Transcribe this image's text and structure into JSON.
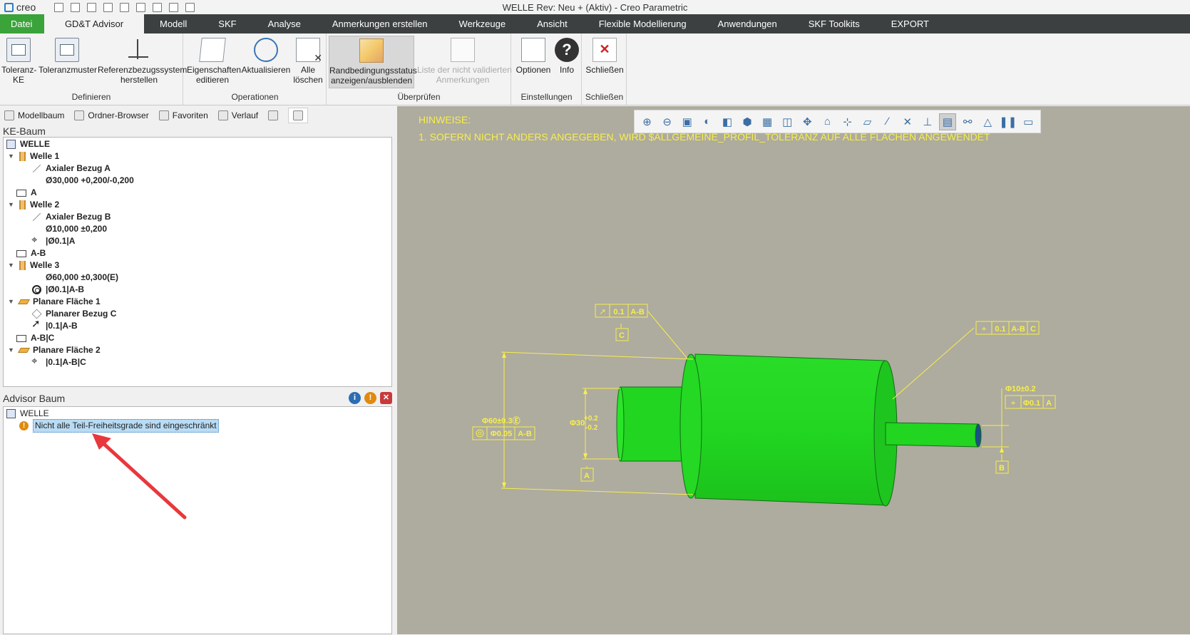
{
  "app": {
    "logo_text": "creo",
    "window_title": "WELLE Rev: Neu + (Aktiv) - Creo Parametric",
    "quick_access_icons": [
      "new-icon",
      "open-icon",
      "folder-icon",
      "save-icon",
      "undo-icon",
      "redo-icon",
      "regenerate-icon",
      "windows-icon",
      "close-window-icon"
    ]
  },
  "menu": {
    "file": "Datei",
    "tabs": [
      "GD&T Advisor",
      "Modell",
      "SKF",
      "Analyse",
      "Anmerkungen erstellen",
      "Werkzeuge",
      "Ansicht",
      "Flexible Modellierung",
      "Anwendungen",
      "SKF Toolkits",
      "EXPORT"
    ],
    "active_tab": "GD&T Advisor"
  },
  "ribbon": {
    "groups": {
      "definieren": "Definieren",
      "operationen": "Operationen",
      "ueberpruefen": "Überprüfen",
      "einstellungen": "Einstellungen",
      "schliessen": "Schließen"
    },
    "buttons": {
      "toleranz_ke_1": "Toleranz-",
      "toleranz_ke_2": "KE",
      "toleranzmuster": "Toleranzmuster",
      "refsys_1": "Referenzbezugssystem",
      "refsys_2": "herstellen",
      "eigenschaften_1": "Eigenschaften",
      "eigenschaften_2": "editieren",
      "aktualisieren": "Aktualisieren",
      "alle_1": "Alle",
      "alle_2": "löschen",
      "randbed_1": "Randbedingungsstatus",
      "randbed_2": "anzeigen/ausblenden",
      "liste_1": "Liste der nicht validierten",
      "liste_2": "Anmerkungen",
      "optionen": "Optionen",
      "info": "Info",
      "info_glyph": "?",
      "schliessen": "Schließen",
      "close_glyph": "✕"
    }
  },
  "navigator": {
    "tabs": [
      "Modellbaum",
      "Ordner-Browser",
      "Favoriten",
      "Verlauf"
    ],
    "ke_tree_title": "KE-Baum",
    "ke_tree": [
      {
        "label": "WELLE",
        "icon": "part-icon",
        "level": 0,
        "expand": ""
      },
      {
        "label": "Welle 1",
        "icon": "feature-icon",
        "level": 0,
        "expand": "▼"
      },
      {
        "label": "Axialer Bezug A",
        "icon": "axis-icon",
        "level": 2,
        "expand": ""
      },
      {
        "label": "Ø30,000 +0,200/-0,200",
        "icon": "",
        "level": 2,
        "expand": ""
      },
      {
        "label": "A",
        "icon": "datum-icon",
        "level": 1,
        "expand": ""
      },
      {
        "label": "Welle 2",
        "icon": "feature-icon",
        "level": 0,
        "expand": "▼"
      },
      {
        "label": "Axialer Bezug B",
        "icon": "axis-icon",
        "level": 2,
        "expand": ""
      },
      {
        "label": "Ø10,000 ±0,200",
        "icon": "",
        "level": 2,
        "expand": ""
      },
      {
        "label": "|Ø0.1|A",
        "icon": "position-icon",
        "level": 2,
        "expand": ""
      },
      {
        "label": "A-B",
        "icon": "datum-icon",
        "level": 1,
        "expand": ""
      },
      {
        "label": "Welle 3",
        "icon": "feature-icon",
        "level": 0,
        "expand": "▼"
      },
      {
        "label": "Ø60,000 ±0,300(E)",
        "icon": "",
        "level": 2,
        "expand": ""
      },
      {
        "label": "|Ø0.1|A-B",
        "icon": "concentricity-icon",
        "level": 2,
        "expand": ""
      },
      {
        "label": "Planare Fläche 1",
        "icon": "plane-icon",
        "level": 0,
        "expand": "▼"
      },
      {
        "label": "Planarer Bezug C",
        "icon": "diamond-icon",
        "level": 2,
        "expand": ""
      },
      {
        "label": "|0.1|A-B",
        "icon": "runout-icon",
        "level": 2,
        "expand": ""
      },
      {
        "label": "A-B|C",
        "icon": "datum-icon",
        "level": 1,
        "expand": ""
      },
      {
        "label": "Planare Fläche 2",
        "icon": "plane-icon",
        "level": 0,
        "expand": "▼"
      },
      {
        "label": "|0.1|A-B|C",
        "icon": "position-icon",
        "level": 2,
        "expand": ""
      }
    ],
    "advisor_title": "Advisor Baum",
    "advisor_buttons": {
      "info": "i",
      "warn": "!",
      "close": "✕"
    },
    "advisor_root": "WELLE",
    "advisor_message": "Nicht alle Teil-Freiheitsgrade sind eingeschränkt",
    "advisor_warn_glyph": "!"
  },
  "viewport": {
    "note_title": "HINWEISE:",
    "note_line": "1. SOFERN NICHT ANDERS ANGEGEBEN, WIRD $ALLGEMEINE_PROFIL_TOLERANZ AUF ALLE FLÄCHEN ANGEWENDET",
    "toolbar_icons": [
      "zoom-in-icon",
      "zoom-out-icon",
      "refit-icon",
      "shaded-icon",
      "view-cube-icon",
      "saved-views-icon",
      "view-manager-icon",
      "perspective-icon",
      "spin-center-icon",
      "section-icon",
      "datum-display-icon",
      "plane-display-icon",
      "axis-display-icon",
      "point-display-icon",
      "csys-display-icon",
      "annotation-display-icon",
      "network-icon",
      "mass-prop-icon",
      "pause-icon",
      "collapse-icon"
    ],
    "toolbar_glyphs": [
      "⊕",
      "⊖",
      "▣",
      "◐",
      "◧",
      "⬢",
      "▦",
      "◫",
      "✥",
      "⌂",
      "⊹",
      "▱",
      "∕",
      "✕",
      "⊥",
      "▤",
      "⚯",
      "△",
      "❚❚",
      "▭"
    ],
    "annotations": {
      "runout_value": "0.1",
      "runout_ref": "A-B",
      "datum_c": "C",
      "pos_value": "0.1",
      "pos_ref1": "A-B",
      "pos_ref2": "C",
      "dim_big": "Φ60±0.3Ⓔ",
      "conc_value": "Φ0.05",
      "conc_ref": "A-B",
      "dim_mid": "Φ30",
      "tol_plus": "+0.2",
      "tol_minus": "-0.2",
      "datum_a": "A",
      "dim_small": "Φ10±0.2",
      "pos2_value": "Φ0.1",
      "pos2_ref": "A",
      "datum_b": "B"
    },
    "colors": {
      "background": "#aeab9f",
      "model": "#22d622",
      "annotation": "#f7ef4a",
      "arrow": "#e8383d"
    }
  }
}
